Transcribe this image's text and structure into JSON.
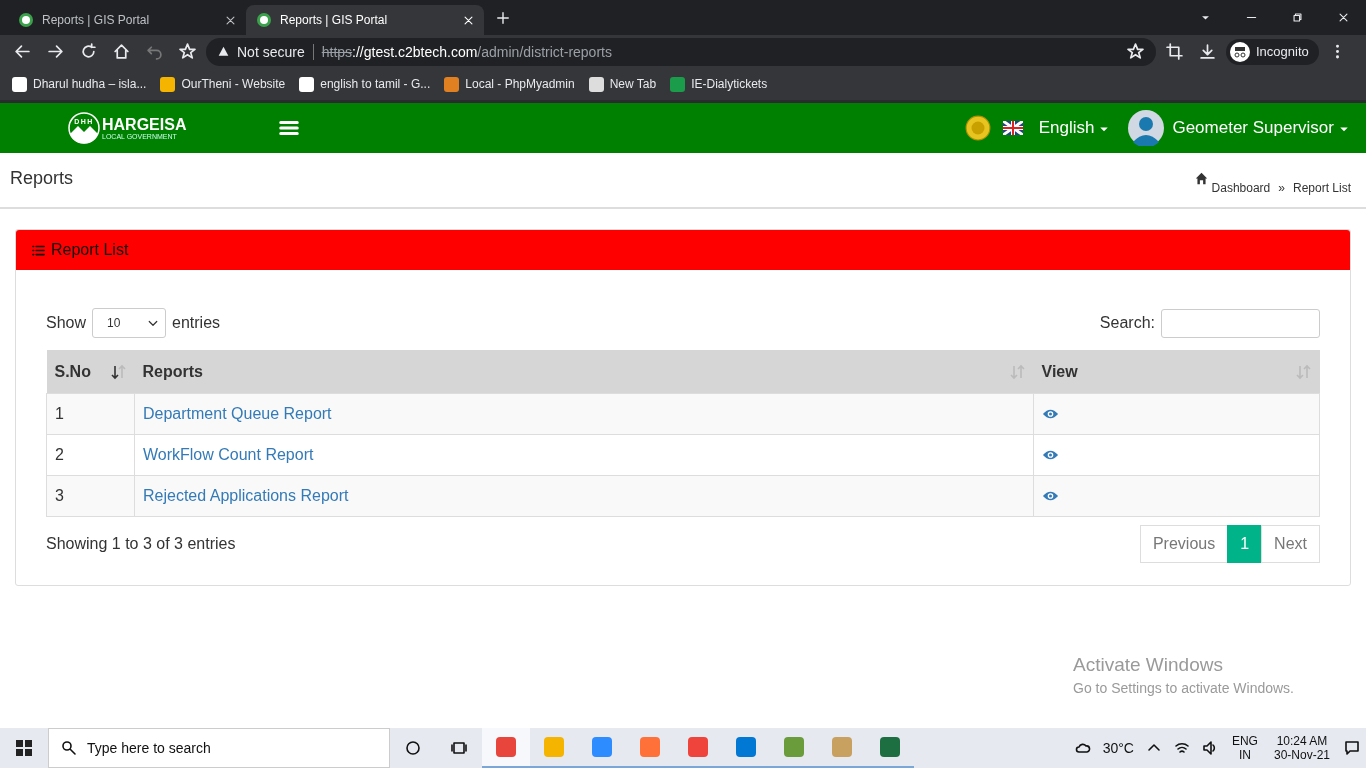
{
  "browser": {
    "tabs": [
      {
        "title": "Reports | GIS Portal",
        "selected": false
      },
      {
        "title": "Reports | GIS Portal",
        "selected": true
      }
    ],
    "address": {
      "security": "Not secure",
      "scheme": "https",
      "host": "://gtest.c2btech.com",
      "path": "/admin/district-reports"
    },
    "profile": "Incognito",
    "bookmarks": [
      "Dharul hudha – isla...",
      "OurTheni - Website",
      "english to tamil - G...",
      "Local - PhpMyadmin",
      "New Tab",
      "IE-Dialytickets"
    ]
  },
  "header": {
    "logo_title": "HARGEISA",
    "logo_subtitle": "LOCAL GOVERNMENT",
    "logo_letters": "DHH",
    "language": "English",
    "user": "Geometer Supervisor"
  },
  "page": {
    "title": "Reports",
    "breadcrumb": [
      "Dashboard",
      "»",
      "Report List"
    ]
  },
  "card": {
    "title": "Report List",
    "length": {
      "show": "Show",
      "value": "10",
      "entries": "entries"
    },
    "search_label": "Search:",
    "table": {
      "columns": [
        {
          "label": "S.No",
          "sorted": true
        },
        {
          "label": "Reports",
          "sorted": false
        },
        {
          "label": "View",
          "sorted": false
        }
      ],
      "rows": [
        {
          "sno": "1",
          "report": "Department Queue Report"
        },
        {
          "sno": "2",
          "report": "WorkFlow Count Report"
        },
        {
          "sno": "3",
          "report": "Rejected Applications Report"
        }
      ]
    },
    "info": "Showing 1 to 3 of 3 entries",
    "pagination": [
      {
        "label": "Previous",
        "selected": false,
        "disabled": true
      },
      {
        "label": "1",
        "selected": true,
        "disabled": false
      },
      {
        "label": "Next",
        "selected": false,
        "disabled": true
      }
    ]
  },
  "activation": {
    "title": "Activate Windows",
    "text": "Go to Settings to activate Windows."
  },
  "taskbar": {
    "search_placeholder": "Type here to search",
    "weather": "30°C",
    "language": "ENG",
    "region": "IN",
    "time": "10:24 AM",
    "date": "30-Nov-21"
  }
}
